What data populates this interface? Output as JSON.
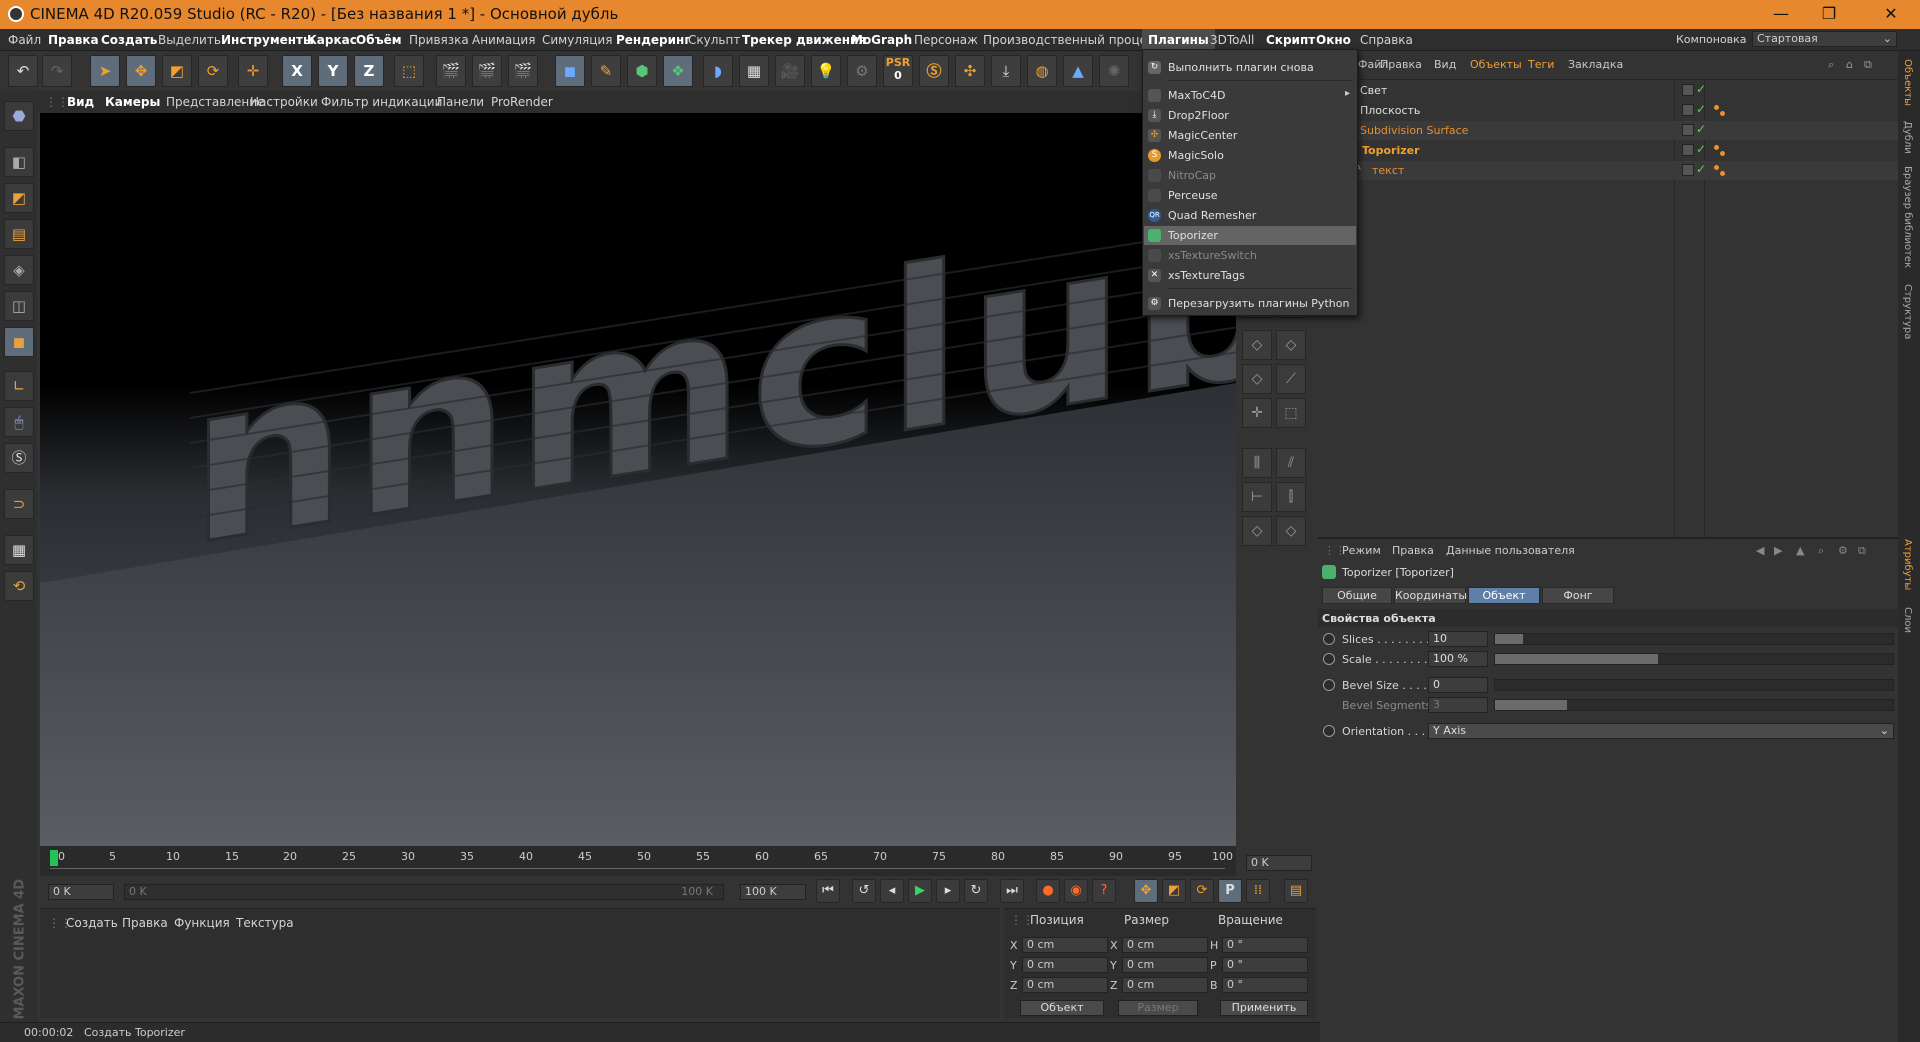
{
  "window": {
    "title": "CINEMA 4D R20.059 Studio (RC - R20) - [Без названия 1 *] - Основной дубль",
    "min": "—",
    "max": "❐",
    "close": "✕"
  },
  "menu": {
    "items": [
      "Файл",
      "Правка",
      "Создать",
      "Выделить",
      "Инструменты",
      "Каркас",
      "Объём",
      "Привязка",
      "Анимация",
      "Симуляция",
      "Рендеринг",
      "Скульпт",
      "Трекер движения",
      "MoGraph",
      "Персонаж",
      "Производственный процесс",
      "Плагины",
      "3DToAll",
      "Скрипт",
      "Окно",
      "Справка"
    ],
    "layout_label": "Компоновка",
    "layout_value": "Стартовая"
  },
  "toolbar": {
    "axis_x": "X",
    "axis_y": "Y",
    "axis_z": "Z",
    "psr": "PSR",
    "psr_num": "0"
  },
  "viewport_menu": [
    "Вид",
    "Камеры",
    "Представление",
    "Настройки",
    "Фильтр индикации",
    "Панели",
    "ProRender"
  ],
  "viewport": {
    "scene_text": "nnmclub"
  },
  "plugins_menu": {
    "items": [
      {
        "label": "Выполнить плагин снова",
        "icon": "refresh-plugin-icon",
        "state": "normal"
      },
      {
        "label": "MaxToC4D",
        "icon": "maxtoc4d-icon",
        "state": "normal",
        "submenu": "▸"
      },
      {
        "label": "Drop2Floor",
        "icon": "drop2floor-icon",
        "state": "normal"
      },
      {
        "label": "MagicCenter",
        "icon": "magiccenter-icon",
        "state": "normal"
      },
      {
        "label": "MagicSolo",
        "icon": "magicsolo-icon",
        "state": "normal"
      },
      {
        "label": "NitroCap",
        "icon": "nitrocap-icon",
        "state": "disabled"
      },
      {
        "label": "Perceuse",
        "icon": "perceuse-icon",
        "state": "normal"
      },
      {
        "label": "Quad Remesher",
        "icon": "quad-remesher-icon",
        "state": "normal"
      },
      {
        "label": "Toporizer",
        "icon": "toporizer-icon",
        "state": "selected"
      },
      {
        "label": "xsTextureSwitch",
        "icon": "xstextureswitch-icon",
        "state": "disabled"
      },
      {
        "label": "xsTextureTags",
        "icon": "xstexturetags-icon",
        "state": "normal"
      },
      {
        "label": "Перезагрузить плагины Python",
        "icon": "python-reload-icon",
        "state": "normal"
      }
    ]
  },
  "object_manager": {
    "menu": [
      "Файл",
      "Правка",
      "Вид",
      "Объекты",
      "Теги",
      "Закладка"
    ],
    "objects": [
      {
        "name": "Свет",
        "style": "normal"
      },
      {
        "name": "Плоскость",
        "style": "normal"
      },
      {
        "name": "Subdivision Surface",
        "style": "orange"
      },
      {
        "name": "Toporizer",
        "style": "highlight"
      },
      {
        "name": "текст",
        "style": "orange"
      }
    ]
  },
  "side_tabs": [
    "Объекты",
    "Дубли",
    "Браузер библиотек",
    "Структура",
    "Атрибуты",
    "Слои"
  ],
  "attributes": {
    "menu": [
      "Режим",
      "Правка",
      "Данные пользователя"
    ],
    "object_title": "Toporizer [Toporizer]",
    "tabs": [
      {
        "label": "Общие"
      },
      {
        "label": "Координаты"
      },
      {
        "label": "Объект",
        "active": true
      },
      {
        "label": "Фонг"
      }
    ],
    "section": "Свойства объекта",
    "params": [
      {
        "label": "Slices . . . . . . . . .",
        "value": "10",
        "fill": 0.07,
        "dim": false
      },
      {
        "label": "Scale . . . . . . . . . .",
        "value": "100 %",
        "fill": 0.41,
        "dim": false
      },
      {
        "label": "Bevel Size . . . . . .",
        "value": "0",
        "fill": 0.0,
        "dim": false
      },
      {
        "label": "Bevel Segments",
        "value": "3",
        "fill": 0.18,
        "dim": true
      }
    ],
    "orientation_label": "Orientation . . .",
    "orientation_value": "Y Axis"
  },
  "timeline": {
    "ticks": [
      "0",
      "5",
      "10",
      "15",
      "20",
      "25",
      "30",
      "35",
      "40",
      "45",
      "50",
      "55",
      "60",
      "65",
      "70",
      "75",
      "80",
      "85",
      "90",
      "95",
      "100"
    ],
    "current_frame": "0 K"
  },
  "transport": {
    "start": "0 K",
    "range_start": "0 K",
    "range_end": "100 K",
    "end": "100 K"
  },
  "material_manager": {
    "menu": [
      "Создать",
      "Правка",
      "Функция",
      "Текстура"
    ]
  },
  "coordinates": {
    "headers": [
      "Позиция",
      "Размер",
      "Вращение"
    ],
    "rows": [
      {
        "axis": "X",
        "pos": "0 cm",
        "size_axis": "X",
        "size": "0 cm",
        "rot_axis": "H",
        "rot": "0 °"
      },
      {
        "axis": "Y",
        "pos": "0 cm",
        "size_axis": "Y",
        "size": "0 cm",
        "rot_axis": "P",
        "rot": "0 °"
      },
      {
        "axis": "Z",
        "pos": "0 cm",
        "size_axis": "Z",
        "size": "0 cm",
        "rot_axis": "B",
        "rot": "0 °"
      }
    ],
    "mode": "Объект",
    "size_mode": "Размер",
    "apply": "Применить"
  },
  "status": {
    "time": "00:00:02",
    "message": "Создать Toporizer"
  },
  "brand": "MAXON CINEMA 4D"
}
